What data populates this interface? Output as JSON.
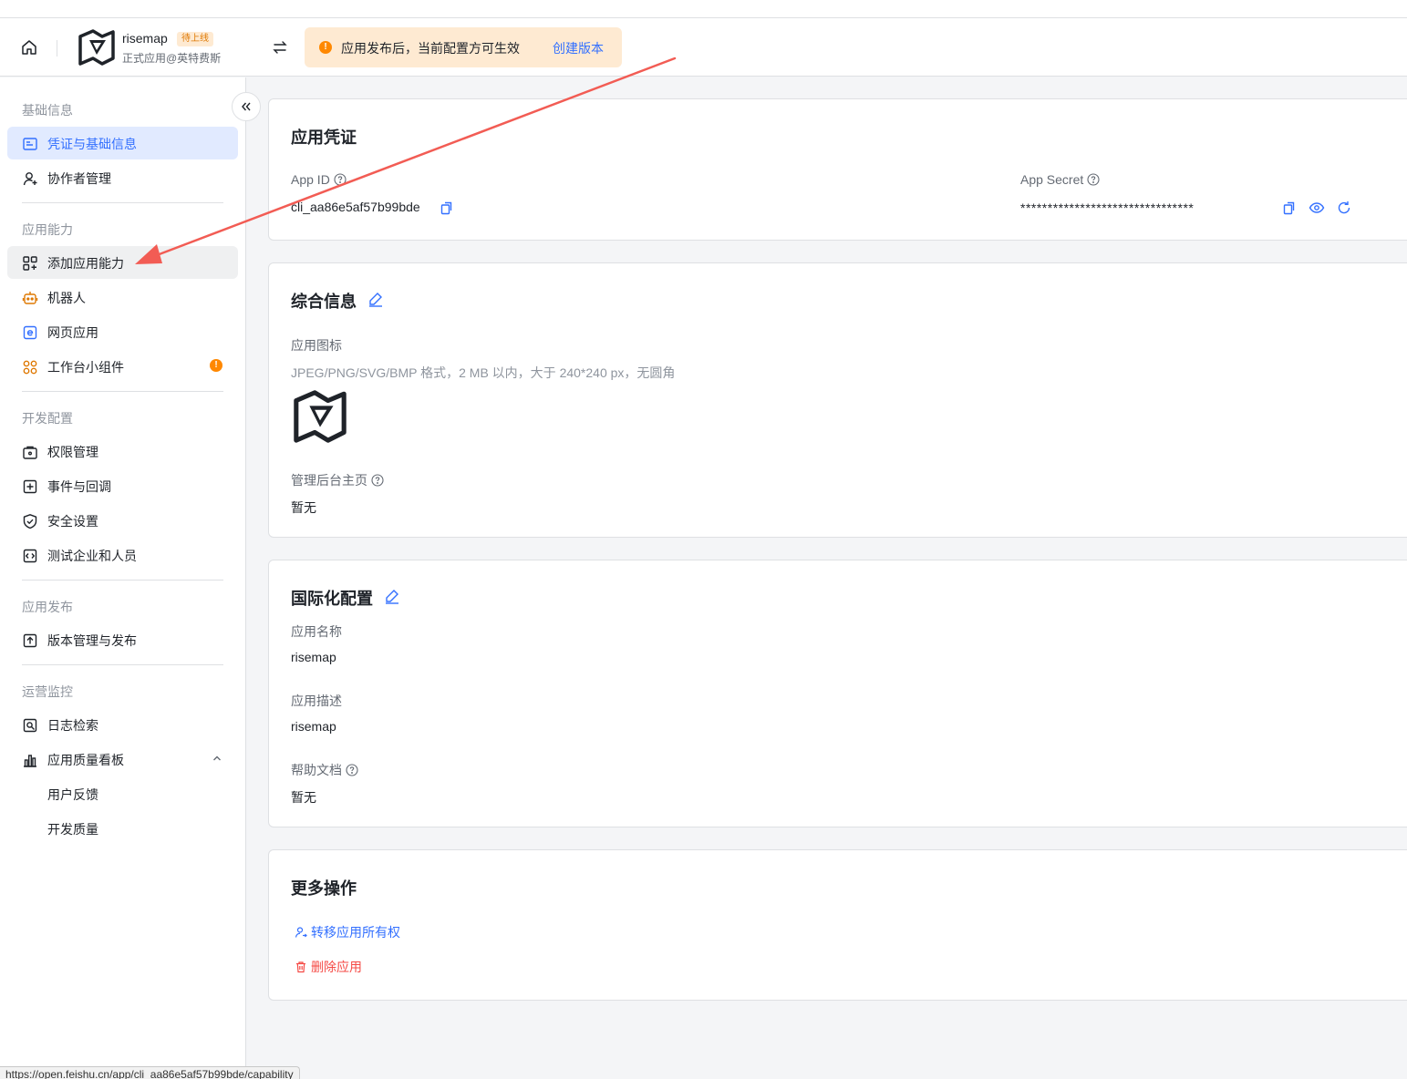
{
  "header": {
    "app_name": "risemap",
    "status_badge": "待上线",
    "app_org": "正式应用@英特费斯",
    "notice_text": "应用发布后，当前配置方可生效",
    "notice_link": "创建版本"
  },
  "sidebar": {
    "sections": {
      "basic": "基础信息",
      "capability": "应用能力",
      "dev": "开发配置",
      "release": "应用发布",
      "ops": "运营监控"
    },
    "items": {
      "credentials": "凭证与基础信息",
      "collaborators": "协作者管理",
      "add_capability": "添加应用能力",
      "bot": "机器人",
      "web_app": "网页应用",
      "widget": "工作台小组件",
      "permissions": "权限管理",
      "events": "事件与回调",
      "security": "安全设置",
      "test_org": "测试企业和人员",
      "versions": "版本管理与发布",
      "logs": "日志检索",
      "quality": "应用质量看板",
      "feedback": "用户反馈",
      "dev_quality": "开发质量"
    }
  },
  "credentials_card": {
    "title": "应用凭证",
    "app_id_label": "App ID",
    "app_id_value": "cli_aa86e5af57b99bde",
    "app_secret_label": "App Secret",
    "app_secret_value": "********************************"
  },
  "info_card": {
    "title": "综合信息",
    "icon_label": "应用图标",
    "icon_hint": "JPEG/PNG/SVG/BMP 格式，2 MB 以内，大于 240*240 px，无圆角",
    "admin_home_label": "管理后台主页",
    "admin_home_value": "暂无"
  },
  "i18n_card": {
    "title": "国际化配置",
    "name_label": "应用名称",
    "name_value": "risemap",
    "desc_label": "应用描述",
    "desc_value": "risemap",
    "help_label": "帮助文档",
    "help_value": "暂无"
  },
  "more_card": {
    "title": "更多操作",
    "transfer": "转移应用所有权",
    "delete": "删除应用"
  },
  "status_bar_url": "https://open.feishu.cn/app/cli_aa86e5af57b99bde/capability",
  "colors": {
    "accent": "#3370ff",
    "warning": "#ff8800",
    "danger": "#f54a45",
    "annotation_arrow": "#f25c54"
  }
}
